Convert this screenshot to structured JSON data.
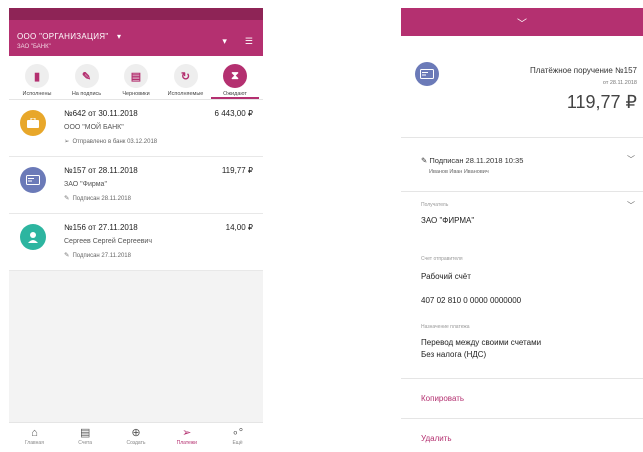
{
  "left": {
    "org_name": "ООО \"ОРГАНИЗАЦИЯ\"",
    "bank_name": "ЗАО \"БАНК\"",
    "filters": [
      {
        "label": "Исполнены",
        "icon": "document-check-icon"
      },
      {
        "label": "На подпись",
        "icon": "signature-icon"
      },
      {
        "label": "Черновики",
        "icon": "draft-icon"
      },
      {
        "label": "Исполняемые",
        "icon": "refresh-icon"
      },
      {
        "label": "Ожидают",
        "icon": "hourglass-icon"
      }
    ],
    "documents": [
      {
        "title": "№642 от 30.11.2018",
        "amount": "6 443,00 ₽",
        "counterparty": "ООО \"МОЙ БАНК\"",
        "status": "Отправлено в банк 03.12.2018",
        "avatar_color": "#e8a72a"
      },
      {
        "title": "№157 от 28.11.2018",
        "amount": "119,77 ₽",
        "counterparty": "ЗАО \"Фирма\"",
        "status": "Подписан 28.11.2018",
        "avatar_color": "#6b7ab8"
      },
      {
        "title": "№156 от 27.11.2018",
        "amount": "14,00 ₽",
        "counterparty": "Сергеев Сергей Сергеевич",
        "status": "Подписан 27.11.2018",
        "avatar_color": "#2db5a0"
      }
    ],
    "nav": [
      {
        "label": "Главная",
        "icon": "home-icon"
      },
      {
        "label": "Счета",
        "icon": "accounts-icon"
      },
      {
        "label": "Создать",
        "icon": "plus-circle-icon"
      },
      {
        "label": "Платежи",
        "icon": "send-icon"
      },
      {
        "label": "Ещё",
        "icon": "more-icon"
      }
    ]
  },
  "right": {
    "doc_title": "Платёжное поручение №157",
    "doc_date": "от 28.11.2018",
    "doc_amount": "119,77 ₽",
    "signed_line": "Подписан 28.11.2018 10:35",
    "signer": "Иванов Иван Иванович",
    "recipient_label": "Получатель",
    "recipient_value": "ЗАО \"ФИРМА\"",
    "account_label": "Счет отправителя",
    "account_name": "Рабочий счёт",
    "account_number": "407 02 810 0 0000 0000000",
    "purpose_label": "Назначение платежа",
    "purpose_line1": "Перевод между своими счетами",
    "purpose_line2": "Без налога (НДС)",
    "copy_label": "Копировать",
    "delete_label": "Удалить"
  },
  "colors": {
    "brand": "#b43070",
    "brand_dark": "#8e2456"
  }
}
